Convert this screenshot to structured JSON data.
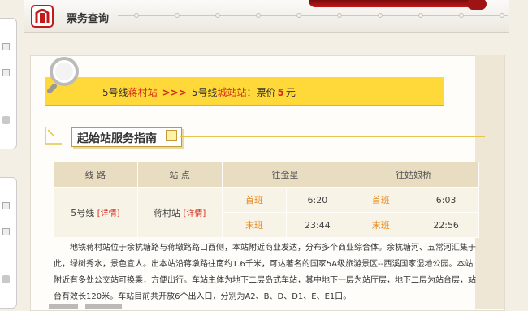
{
  "header": {
    "title": "票务查询"
  },
  "route": {
    "from_line": "5号线",
    "from_station": "蒋村站",
    "arrows": ">>>",
    "to_line": "5号线",
    "to_station": "城站站",
    "price_label": "：票价",
    "price": "5",
    "price_unit": "元"
  },
  "guide": {
    "title": "起始站服务指南"
  },
  "table": {
    "headers": [
      "线 路",
      "站 点",
      "往金星",
      "往姑娘桥"
    ],
    "line": "5号线",
    "line_detail": "[详情]",
    "station": "蒋村站",
    "station_detail": "[详情]",
    "first_label": "首班",
    "last_label": "末班",
    "dir1_first": "6:20",
    "dir1_last": "23:44",
    "dir2_first": "6:03",
    "dir2_last": "22:56"
  },
  "description": "地铁蒋村站位于余杭塘路与蒋墩路路口西侧，本站附近商业发达，分布多个商业综合体。余杭塘河、五常河汇集于此，绿树秀水，景色宜人。出本站沿蒋墩路往南约1.6千米，可达著名的国家5A级旅游景区--西溪国家湿地公园。本站附近有多处公交站可换乘，方便出行。车站主体为地下二层岛式车站，其中地下一层为站厅层，地下二层为站台层，站台有效长120米。车站目前共开放6个出入口，分别为A2、B、D、D1、E、E1口。",
  "colors": {
    "accent_red": "#d42a1a",
    "banner_yellow": "#ffd93a",
    "time_orange": "#e88a1a"
  }
}
